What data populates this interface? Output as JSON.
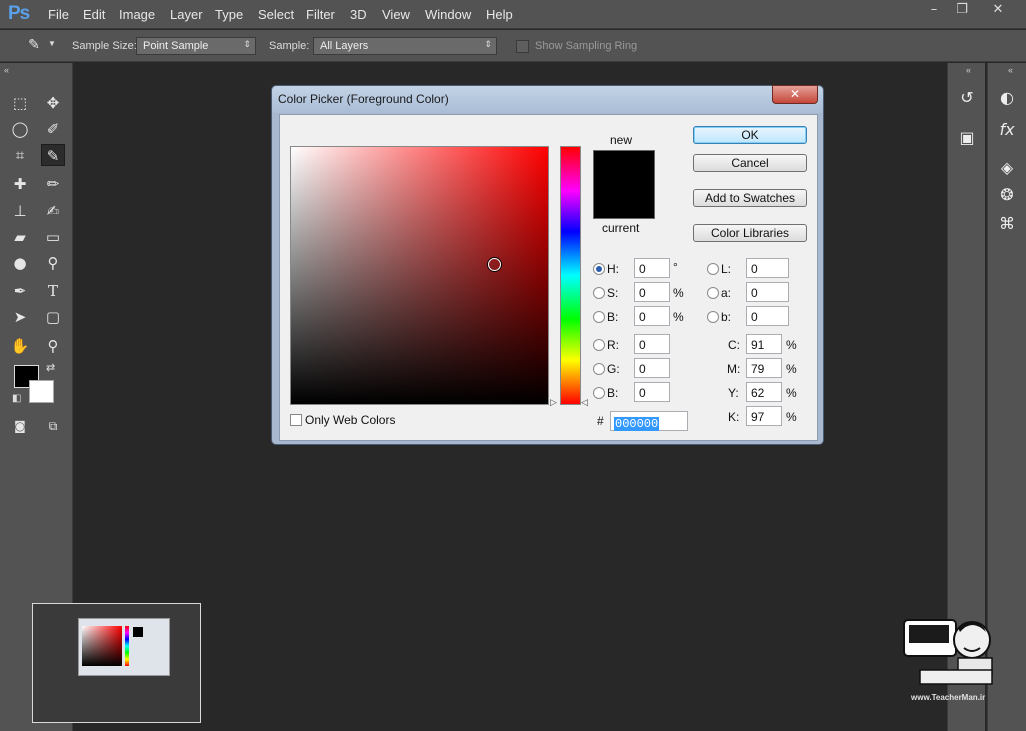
{
  "app": {
    "logo": "Ps"
  },
  "menu": [
    "File",
    "Edit",
    "Image",
    "Layer",
    "Type",
    "Select",
    "Filter",
    "3D",
    "View",
    "Window",
    "Help"
  ],
  "window_controls": {
    "minimize": "–",
    "restore": "❐",
    "close": "✕"
  },
  "options_bar": {
    "sample_size_label": "Sample Size:",
    "sample_size_value": "Point Sample",
    "sample_label": "Sample:",
    "sample_value": "All Layers",
    "sampling_ring_label": "Show Sampling Ring"
  },
  "dialog": {
    "title": "Color Picker (Foreground Color)",
    "new_label": "new",
    "current_label": "current",
    "new_color": "#000000",
    "current_color": "#000000",
    "buttons": {
      "ok": "OK",
      "cancel": "Cancel",
      "add_to_swatches": "Add to Swatches",
      "color_libraries": "Color Libraries"
    },
    "only_web_colors": "Only Web Colors",
    "hsb": {
      "h": {
        "label": "H:",
        "value": "0",
        "unit": "°"
      },
      "s": {
        "label": "S:",
        "value": "0",
        "unit": "%"
      },
      "b": {
        "label": "B:",
        "value": "0",
        "unit": "%"
      }
    },
    "rgb": {
      "r": {
        "label": "R:",
        "value": "0"
      },
      "g": {
        "label": "G:",
        "value": "0"
      },
      "b": {
        "label": "B:",
        "value": "0"
      }
    },
    "lab": {
      "l": {
        "label": "L:",
        "value": "0"
      },
      "a": {
        "label": "a:",
        "value": "0"
      },
      "b": {
        "label": "b:",
        "value": "0"
      }
    },
    "cmyk": {
      "c": {
        "label": "C:",
        "value": "91",
        "unit": "%"
      },
      "m": {
        "label": "M:",
        "value": "79",
        "unit": "%"
      },
      "y": {
        "label": "Y:",
        "value": "62",
        "unit": "%"
      },
      "k": {
        "label": "K:",
        "value": "97",
        "unit": "%"
      }
    },
    "hex_label": "#",
    "hex_value": "000000"
  },
  "watermark": {
    "url_text": "www.TeacherMan.ir"
  }
}
